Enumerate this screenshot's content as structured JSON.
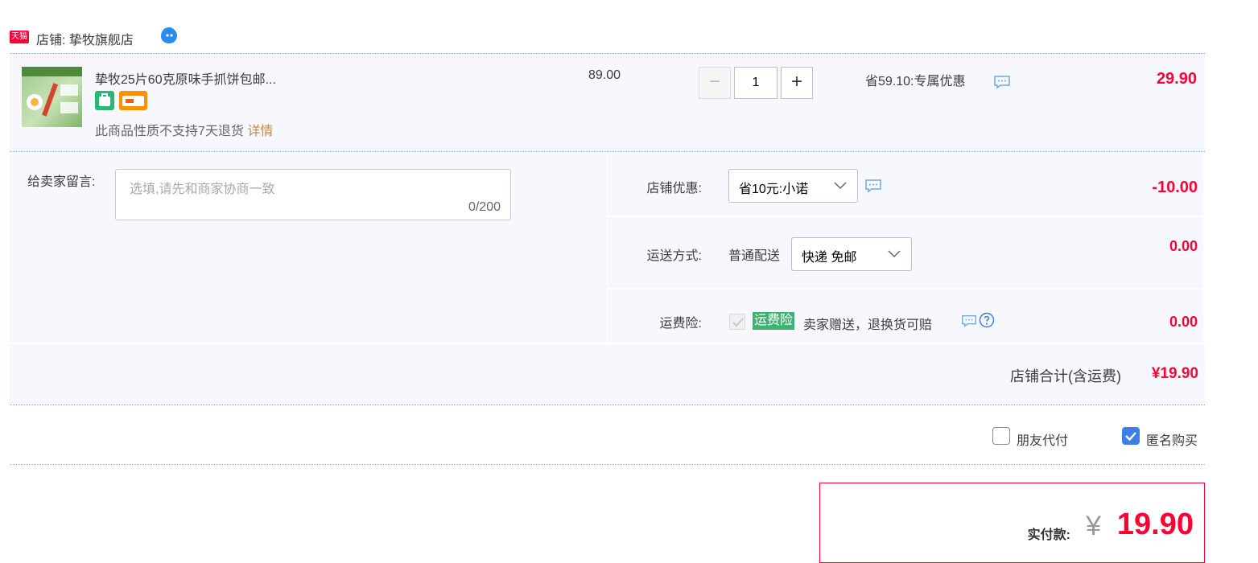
{
  "shop": {
    "logo_text": "天猫",
    "name_label": "店铺: 挚牧旗舰店"
  },
  "item": {
    "title": "挚牧25片60克原味手抓饼包邮...",
    "return_note": "此商品性质不支持7天退货",
    "return_detail": "详情",
    "unit_price": "89.00",
    "quantity": "1",
    "quantity_minus": "−",
    "quantity_plus": "+",
    "promo": "省59.10:专属优惠",
    "total": "29.90"
  },
  "message": {
    "label": "给卖家留言:",
    "placeholder": "选填,请先和商家协商一致",
    "counter": "0/200"
  },
  "discount": {
    "label": "店铺优惠:",
    "selected": "省10元:小诺",
    "amount": "-10.00"
  },
  "shipping": {
    "label": "运送方式:",
    "method": "普通配送",
    "selected": "快递 免邮",
    "amount": "0.00"
  },
  "insurance": {
    "label": "运费险:",
    "tag": "运费险",
    "desc": "卖家赠送，退换货可赔",
    "amount": "0.00"
  },
  "shop_total": {
    "label": "店铺合计(含运费)",
    "value": "¥19.90"
  },
  "options": {
    "friend_pay": "朋友代付",
    "friend_pay_checked": false,
    "anonymous": "匿名购买",
    "anonymous_checked": true
  },
  "payment": {
    "label": "实付款:",
    "currency": "¥",
    "amount": "19.90"
  },
  "colors": {
    "accent_red": "#ff0036",
    "row_bg": "#f6f8fe",
    "check_blue": "#3d7fe3",
    "insurance_green": "#3cb371"
  }
}
